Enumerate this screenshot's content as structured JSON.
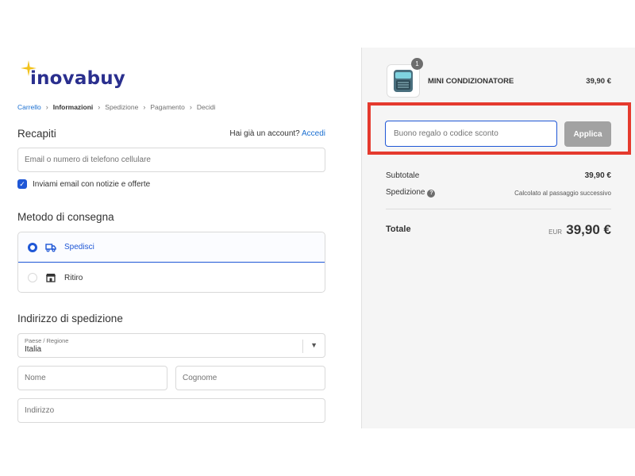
{
  "brand": {
    "logo_text": "inovabuy",
    "logo_color": "#2a2f8e",
    "star_color": "#f2c21b"
  },
  "breadcrumb": {
    "items": [
      "Carrello",
      "Informazioni",
      "Spedizione",
      "Pagamento",
      "Decidi"
    ],
    "current": "Informazioni",
    "separator_icon": "chevron-right-icon"
  },
  "contact": {
    "title": "Recapiti",
    "account_prompt": "Hai già un account?",
    "login_link": "Accedi",
    "email_placeholder": "Email o numero di telefono cellulare",
    "newsletter_label": "Inviami email con notizie e offerte",
    "newsletter_checked": true
  },
  "delivery": {
    "title": "Metodo di consegna",
    "options": [
      {
        "label": "Spedisci",
        "icon": "truck-icon",
        "selected": true
      },
      {
        "label": "Ritiro",
        "icon": "store-icon",
        "selected": false
      }
    ]
  },
  "shipping": {
    "title": "Indirizzo di spedizione",
    "country_label": "Paese / Regione",
    "country_value": "Italia",
    "first_name_placeholder": "Nome",
    "last_name_placeholder": "Cognome",
    "address_placeholder": "Indirizzo"
  },
  "order": {
    "product": {
      "name": "MINI CONDIZIONATORE",
      "price": "39,90 €",
      "quantity": "1",
      "thumb_icon": "air-cooler-icon"
    },
    "discount_placeholder": "Buono regalo o codice sconto",
    "apply_label": "Applica",
    "subtotal_label": "Subtotale",
    "subtotal_value": "39,90 €",
    "shipping_label": "Spedizione",
    "shipping_note": "Calcolato al passaggio successivo",
    "total_label": "Totale",
    "currency": "EUR",
    "total_value": "39,90 €"
  },
  "colors": {
    "accent": "#1f57d6",
    "link": "#1a6fd1",
    "highlight": "#e53a2e",
    "apply_button": "#a2a2a2"
  }
}
